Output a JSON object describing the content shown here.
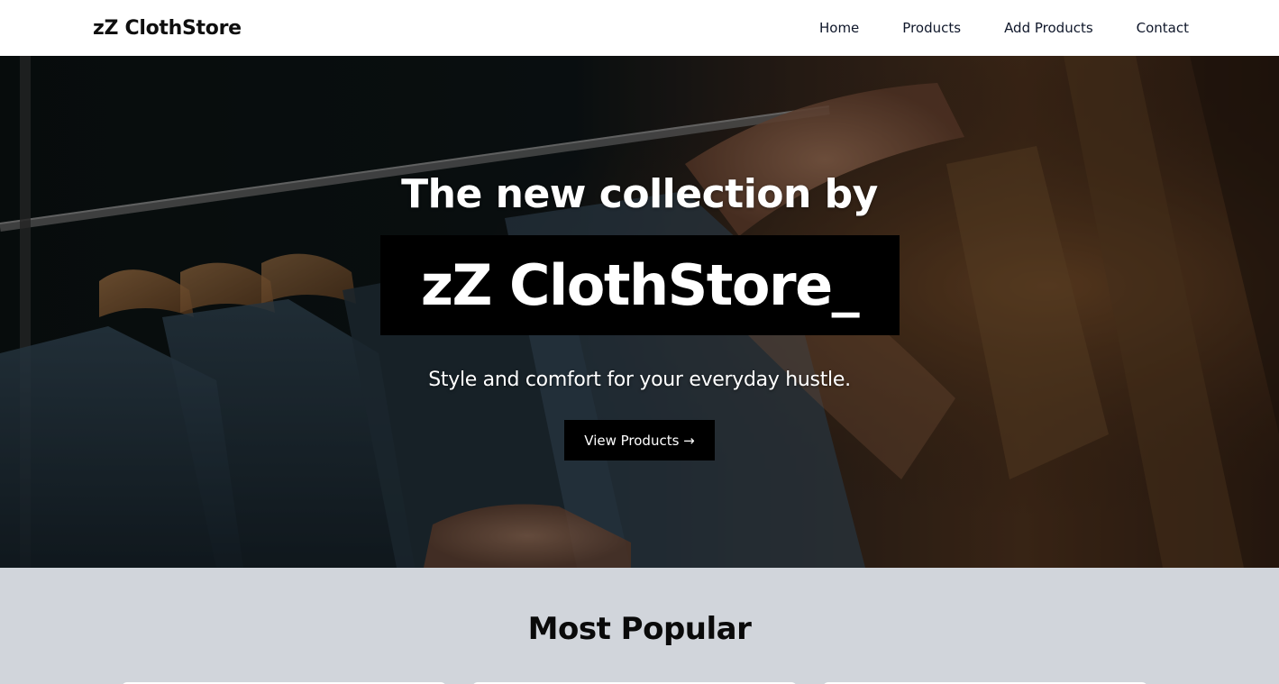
{
  "nav": {
    "brand": "zZ ClothStore",
    "links": [
      {
        "label": "Home"
      },
      {
        "label": "Products"
      },
      {
        "label": "Add Products"
      },
      {
        "label": "Contact"
      }
    ]
  },
  "hero": {
    "title": "The new collection by",
    "brand": "zZ ClothStore_",
    "tagline": "Style and comfort for your everyday hustle.",
    "button_label": "View Products →",
    "background_image": "clothing-rack-photo"
  },
  "popular": {
    "heading": "Most Popular"
  },
  "colors": {
    "nav_bg": "#ffffff",
    "section_bg": "#d1d5db",
    "button_bg": "#000000",
    "text_light": "#ffffff"
  }
}
